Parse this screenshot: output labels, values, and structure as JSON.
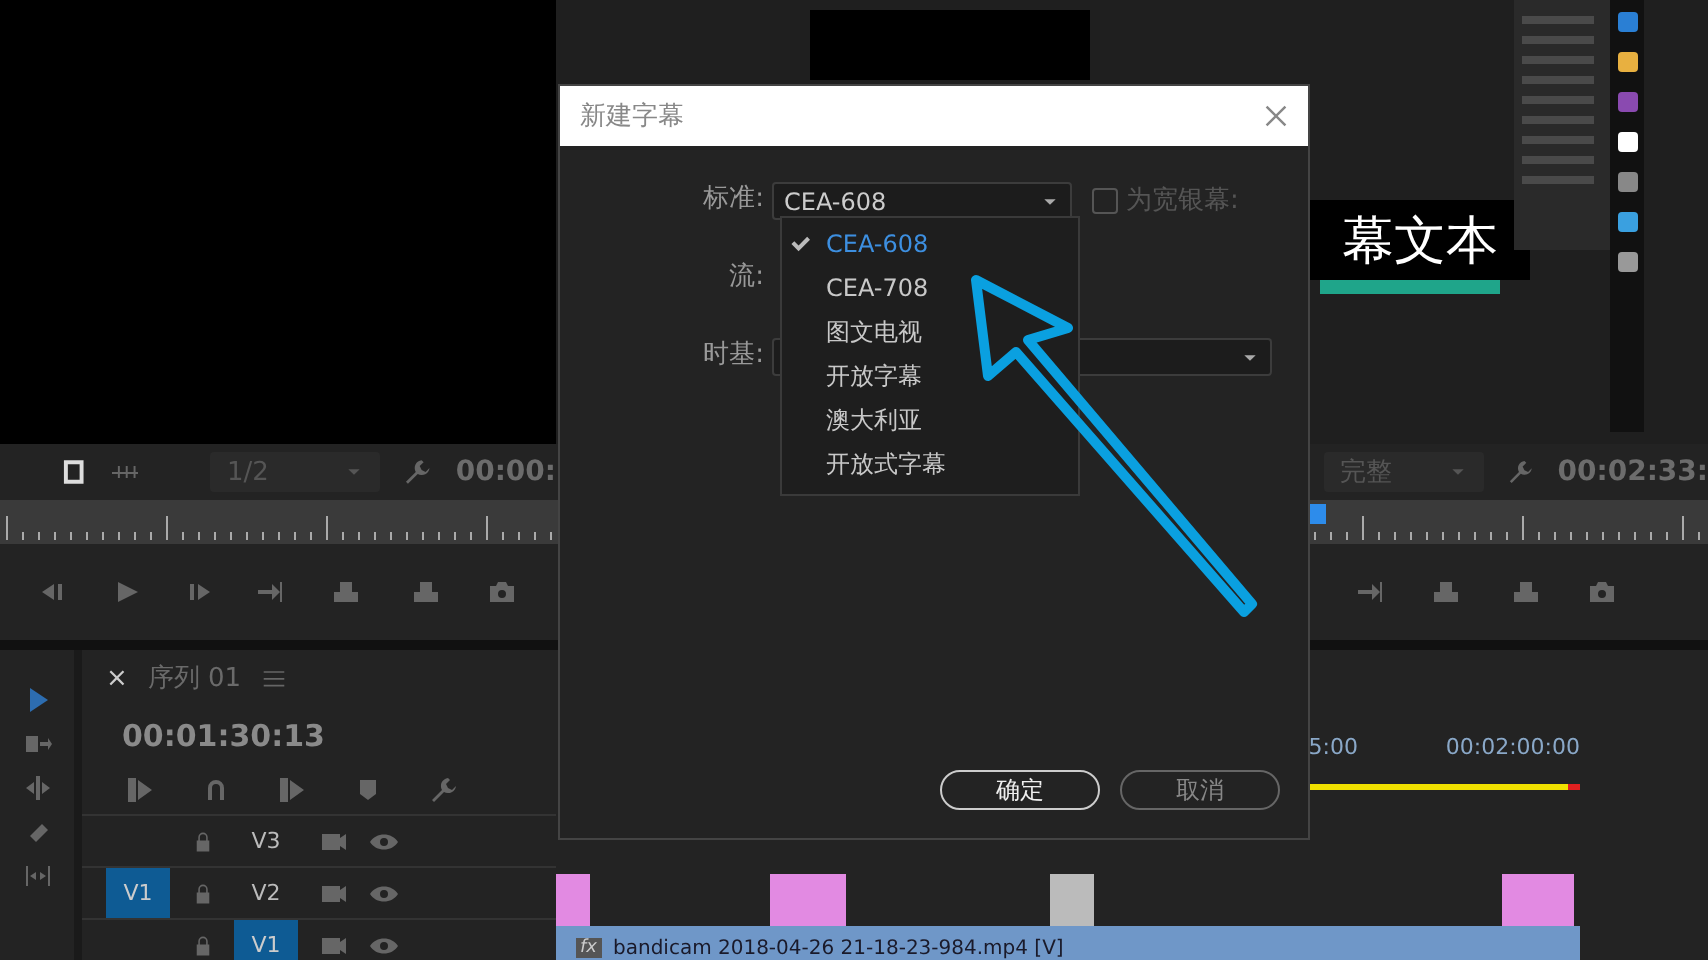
{
  "program_monitor": {
    "scale": "1/2",
    "timecode": "00:00:"
  },
  "source_monitor": {
    "quality": "完整",
    "timecode": "00:02:33:",
    "caption_preview": "幕文本"
  },
  "sequence": {
    "tab": "序列 01",
    "close": "×",
    "timecode": "00:01:30:13",
    "ruler_labels": [
      "5:00",
      "00:02:00:00"
    ],
    "tracks": [
      {
        "name": "V3",
        "targeted": false
      },
      {
        "name": "V2",
        "targeted": false,
        "source_patch": "V1"
      },
      {
        "name": "V1",
        "targeted": true
      }
    ],
    "fx_badge": "fx",
    "clip": "bandicam 2018-04-26 21-18-23-984.mp4 [V]"
  },
  "dialog": {
    "title": "新建字幕",
    "fields": [
      {
        "label": "标准:",
        "kind": "select",
        "value": "CEA-608"
      },
      {
        "label": "流:",
        "kind": "empty"
      },
      {
        "label": "时基:",
        "kind": "select"
      }
    ],
    "widescreen": {
      "label": "为宽银幕:",
      "checked": false,
      "disabled": true
    },
    "menu": [
      {
        "label": "CEA-608",
        "selected": true
      },
      {
        "label": "CEA-708",
        "selected": false
      },
      {
        "label": "图文电视",
        "selected": false
      },
      {
        "label": "开放字幕",
        "selected": false
      },
      {
        "label": "澳大利亚",
        "selected": false
      },
      {
        "label": "开放式字幕",
        "selected": false
      }
    ],
    "buttons": [
      {
        "label": "确定",
        "kind": "primary"
      },
      {
        "label": "取消",
        "kind": "secondary"
      }
    ]
  }
}
